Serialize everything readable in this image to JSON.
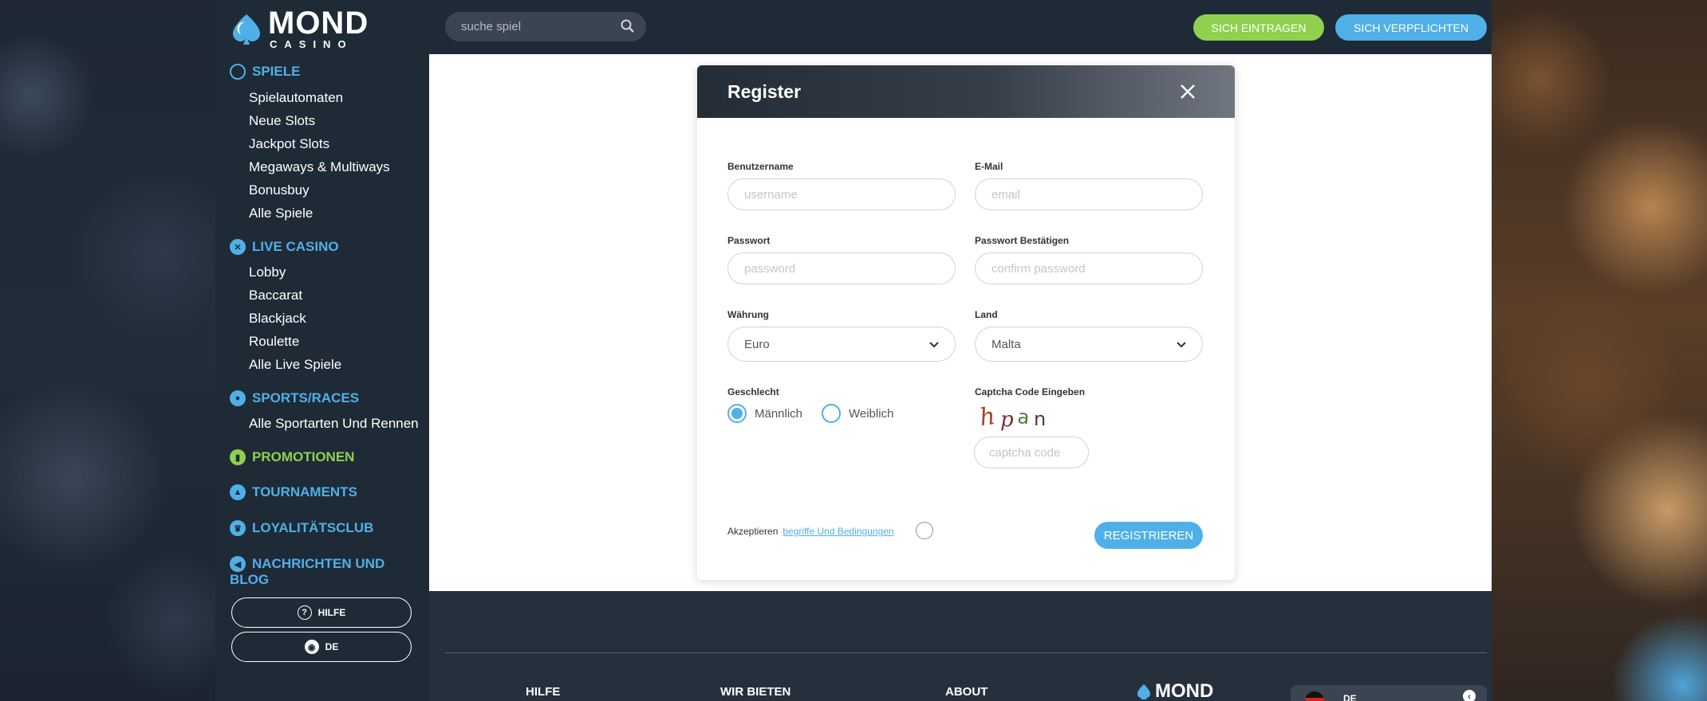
{
  "brand": {
    "name": "MOND",
    "sub": "CASINO"
  },
  "search": {
    "placeholder": "suche spiel"
  },
  "header": {
    "signup": "SICH EINTRAGEN",
    "commit": "SICH VERPFLICHTEN"
  },
  "sidebar": {
    "sections": [
      {
        "title": "SPIELE",
        "items": [
          "Spielautomaten",
          "Neue Slots",
          "Jackpot Slots",
          "Megaways & Multiways",
          "Bonusbuy",
          "Alle Spiele"
        ]
      },
      {
        "title": "LIVE CASINO",
        "items": [
          "Lobby",
          "Baccarat",
          "Blackjack",
          "Roulette",
          "Alle Live Spiele"
        ]
      },
      {
        "title": "SPORTS/RACES",
        "items": [
          "Alle Sportarten Und Rennen"
        ]
      },
      {
        "title": "PROMOTIONEN",
        "items": []
      },
      {
        "title": "TOURNAMENTS",
        "items": []
      },
      {
        "title": "LOYALITÄTSCLUB",
        "items": []
      },
      {
        "title": "NACHRICHTEN UND",
        "title2": "BLOG",
        "items": []
      }
    ],
    "help_button": "HILFE",
    "lang_button": "DE"
  },
  "modal": {
    "title": "Register",
    "fields": {
      "username_label": "Benutzername",
      "username_placeholder": "username",
      "email_label": "E-Mail",
      "email_placeholder": "email",
      "password_label": "Passwort",
      "password_placeholder": "password",
      "confirm_label": "Passwort Bestätigen",
      "confirm_placeholder": "confirm password",
      "currency_label": "Währung",
      "currency_value": "Euro",
      "country_label": "Land",
      "country_value": "Malta",
      "gender_label": "Geschlecht",
      "gender_male": "Männlich",
      "gender_female": "Weiblich",
      "gender_selected": "male",
      "captcha_label": "Captcha Code Eingeben",
      "captcha_text": "hpan",
      "captcha_placeholder": "captcha code"
    },
    "accept_text": "Akzeptieren",
    "accept_link": "begriffe Und Bedingungen",
    "register_button": "REGISTRIEREN"
  },
  "footer": {
    "cols": [
      "HILFE",
      "WIR BIETEN",
      "ABOUT"
    ],
    "logo": "MOND",
    "lang": "DE"
  },
  "colors": {
    "blue": "#4fb0e8",
    "green": "#8fd14f",
    "dark": "#1f2a37"
  }
}
